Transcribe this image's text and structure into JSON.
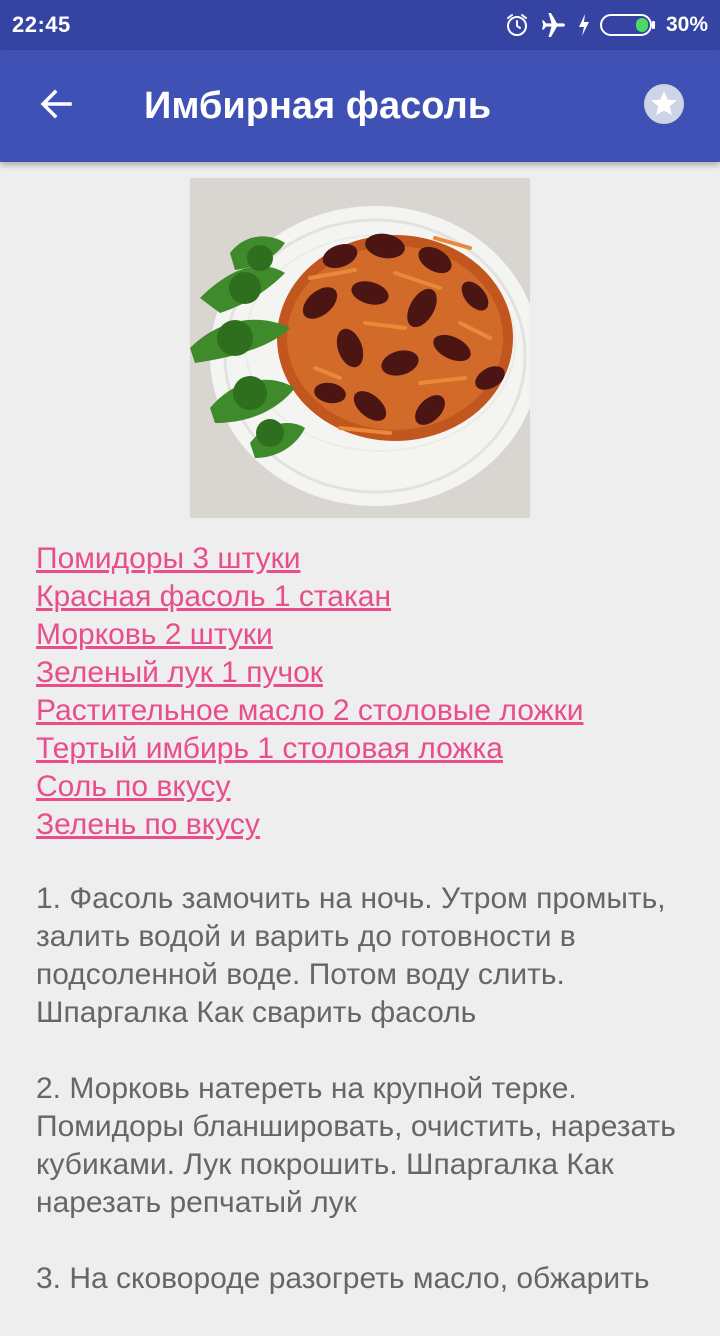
{
  "status_bar": {
    "time": "22:45",
    "icons": [
      "alarm-icon",
      "airplane-icon",
      "charging-icon",
      "battery-icon"
    ],
    "battery": "30%"
  },
  "app_bar": {
    "title": "Имбирная фасоль",
    "back_icon": "arrow-back-icon",
    "favorite_icon": "star-icon",
    "color": "#3f51b5"
  },
  "recipe": {
    "photo": "dish-photo",
    "ingredients": [
      "Помидоры 3 штуки",
      "Красная фасоль 1 стакан",
      "Морковь 2 штуки",
      "Зеленый лук 1 пучок",
      "Растительное масло 2 столовые ложки",
      "Тертый имбирь 1 столовая ложка",
      "Соль по вкусу",
      "Зелень по вкусу"
    ],
    "steps": [
      "1. Фасоль замочить на ночь. Утром промыть, залить водой и варить до готовности в подсоленной воде. Потом воду слить. Шпаргалка Как сварить фасоль",
      "2. Морковь натереть на крупной терке. Помидоры бланшировать, очистить, нарезать кубиками. Лук покрошить. Шпаргалка Как нарезать репчатый лук",
      "3. На сковороде разогреть масло, обжарить"
    ]
  },
  "colors": {
    "status_bar": "#3543a3",
    "link": "#e94d8c",
    "body_text": "#666666",
    "background": "#eeeeee"
  }
}
